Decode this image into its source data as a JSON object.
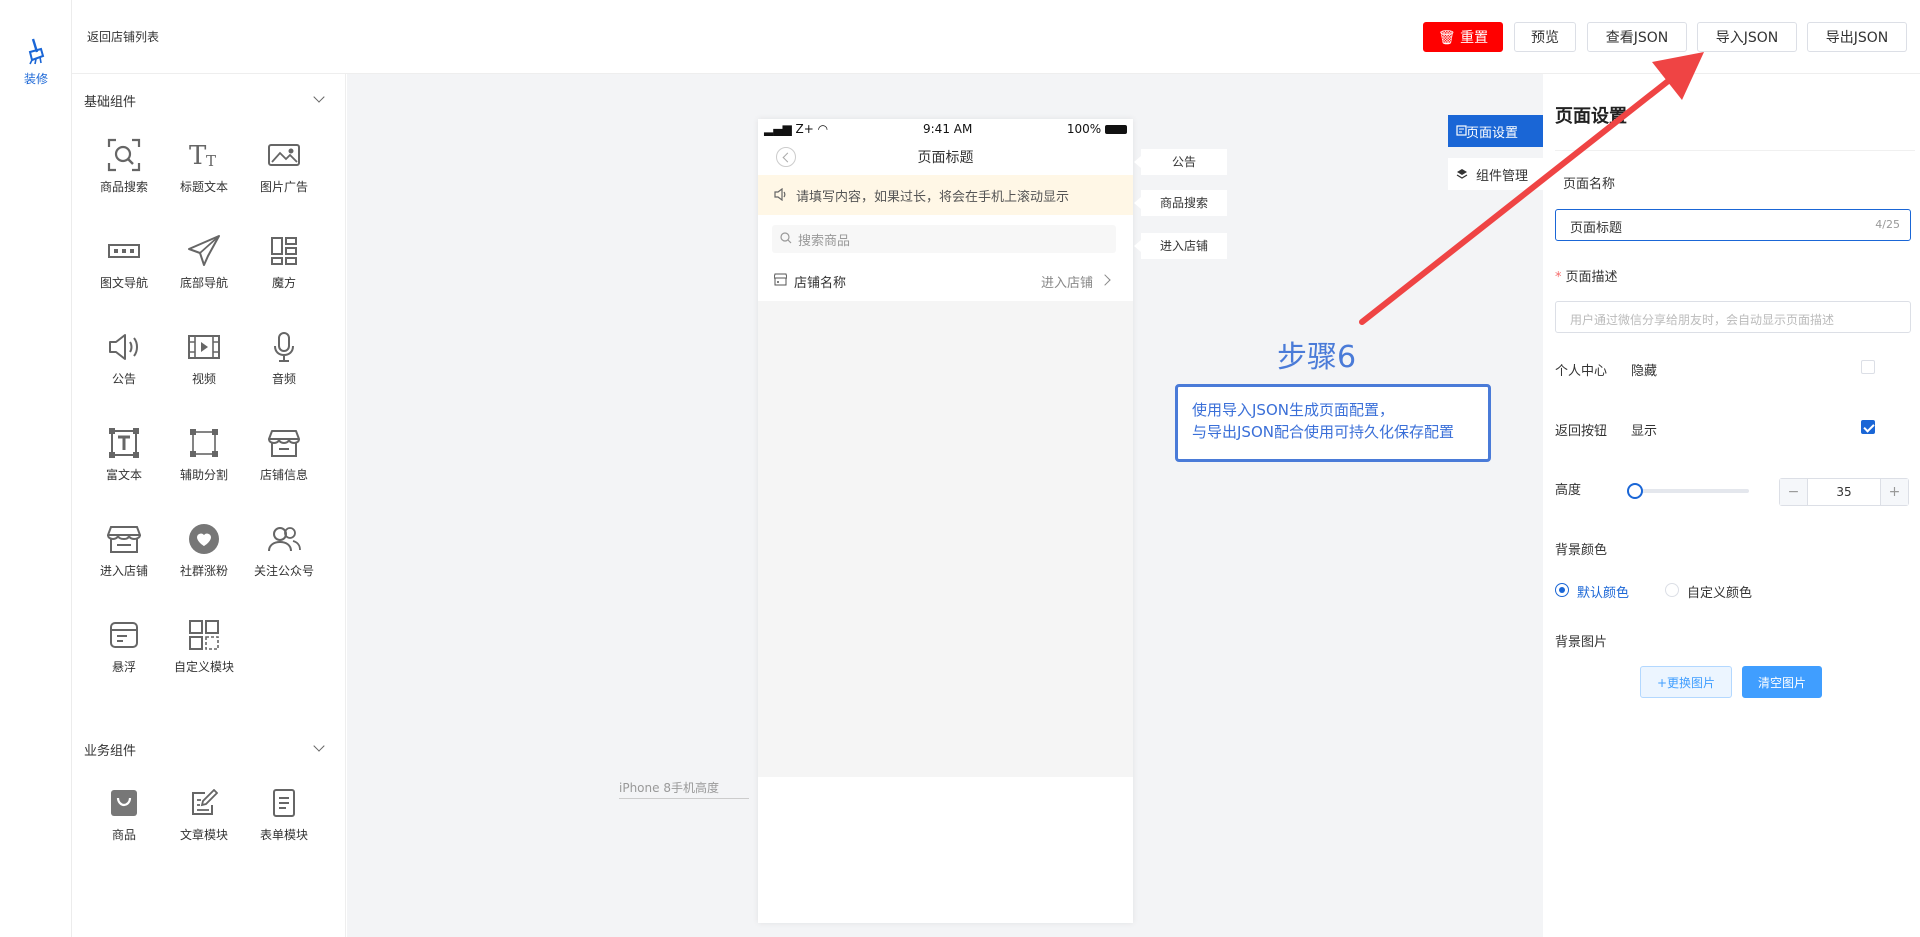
{
  "nav": {
    "label": "装修"
  },
  "header": {
    "back_label": "返回店铺列表",
    "reset_label": "重置",
    "preview_label": "预览",
    "view_json_label": "查看JSON",
    "import_json_label": "导入JSON",
    "export_json_label": "导出JSON"
  },
  "panel": {
    "basic_title": "基础组件",
    "basic_items": [
      {
        "label": "商品搜索",
        "icon": "search-icon"
      },
      {
        "label": "标题文本",
        "icon": "text-icon"
      },
      {
        "label": "图片广告",
        "icon": "image-icon"
      },
      {
        "label": "图文导航",
        "icon": "nav-icon"
      },
      {
        "label": "底部导航",
        "icon": "paper-plane-icon"
      },
      {
        "label": "魔方",
        "icon": "cube-icon"
      },
      {
        "label": "公告",
        "icon": "speaker-icon"
      },
      {
        "label": "视频",
        "icon": "video-icon"
      },
      {
        "label": "音频",
        "icon": "mic-icon"
      },
      {
        "label": "富文本",
        "icon": "rich-text-icon"
      },
      {
        "label": "辅助分割",
        "icon": "divider-icon"
      },
      {
        "label": "店铺信息",
        "icon": "store-icon"
      },
      {
        "label": "进入店铺",
        "icon": "enter-store-icon"
      },
      {
        "label": "社群涨粉",
        "icon": "community-icon"
      },
      {
        "label": "关注公众号",
        "icon": "follow-icon"
      },
      {
        "label": "悬浮",
        "icon": "float-icon"
      },
      {
        "label": "自定义模块",
        "icon": "custom-module-icon"
      }
    ],
    "business_title": "业务组件",
    "business_items": [
      {
        "label": "商品",
        "icon": "bag-icon"
      },
      {
        "label": "文章模块",
        "icon": "article-icon"
      },
      {
        "label": "表单模块",
        "icon": "form-icon"
      }
    ]
  },
  "phone": {
    "carrier": "Z+",
    "time": "9:41 AM",
    "battery": "100%",
    "title": "页面标题",
    "notice_text": "请填写内容，如果过长，将会在手机上滚动显示",
    "search_placeholder": "搜索商品",
    "store_name": "店铺名称",
    "enter_store": "进入店铺"
  },
  "tags": {
    "notice": "公告",
    "search": "商品搜索",
    "enter_store": "进入店铺"
  },
  "canvas": {
    "iphone_label": "iPhone 8手机高度",
    "step_title": "步骤6",
    "step_line1": "使用导入JSON生成页面配置，",
    "step_line2": "与导出JSON配合使用可持久化保存配置",
    "page_settings_btn": "页面设置",
    "component_manage_btn": "组件管理",
    "arrow_color": "#ef4444"
  },
  "settings": {
    "title": "页面设置",
    "name_label": "页面名称",
    "name_value": "页面标题",
    "name_counter": "4/25",
    "desc_label": "页面描述",
    "desc_placeholder": "用户通过微信分享给朋友时，会自动显示页面描述",
    "personal_center_label": "个人中心",
    "personal_center_value": "隐藏",
    "personal_center_checked": false,
    "back_button_label": "返回按钮",
    "back_button_value": "显示",
    "back_button_checked": true,
    "height_label": "高度",
    "height_value": "35",
    "bg_color_label": "背景颜色",
    "bg_color_default": "默认颜色",
    "bg_color_custom": "自定义颜色",
    "bg_image_label": "背景图片",
    "change_image_btn": "+更换图片",
    "clear_image_btn": "清空图片"
  }
}
